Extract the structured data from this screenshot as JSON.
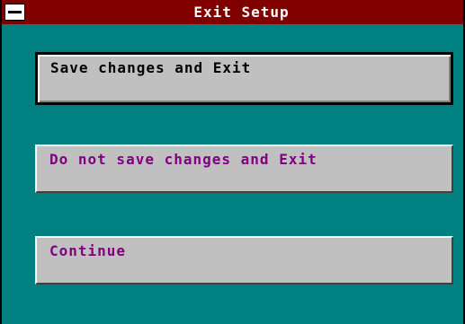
{
  "window": {
    "title": "Exit Setup"
  },
  "buttons": {
    "save_exit": "Save changes and Exit",
    "nosave_exit": "Do not save changes and Exit",
    "continue": "Continue"
  },
  "colors": {
    "titlebar": "#800000",
    "background": "#008080",
    "button_face": "#c0c0c0",
    "button_text": "#800080"
  }
}
